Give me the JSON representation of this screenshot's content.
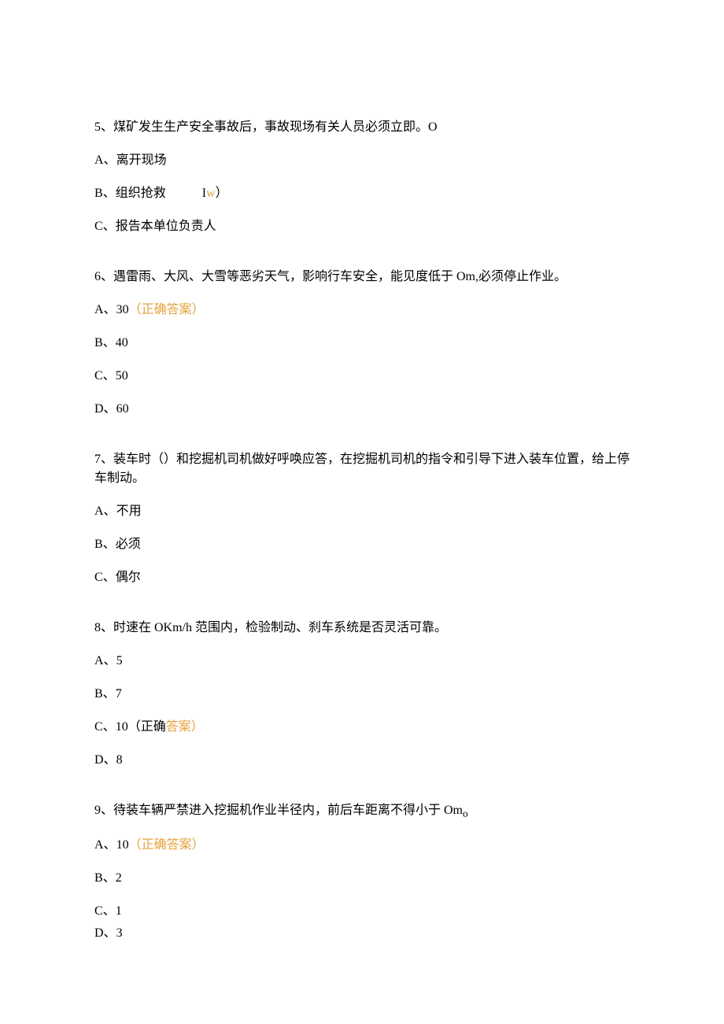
{
  "questions": [
    {
      "number": "5",
      "text": "、煤矿发生生产安全事故后，事故现场有关人员必须立即。O",
      "options": [
        {
          "label": "A、",
          "value": "离开现场",
          "inline_marker_prefix": "",
          "inline_marker_body": "",
          "inline_marker_suffix": ""
        },
        {
          "label": "B、",
          "value": "组织抢救",
          "inline_marker_prefix": "I",
          "inline_marker_body": "w",
          "inline_marker_suffix": "）"
        },
        {
          "label": "C、",
          "value": "报告本单位负责人",
          "inline_marker_prefix": "",
          "inline_marker_body": "",
          "inline_marker_suffix": ""
        }
      ]
    },
    {
      "number": "6",
      "text": "、遇雷雨、大风、大雪等恶劣天气，影响行车安全，能见度低于 Om,必须停止作业。",
      "options": [
        {
          "label": "A、",
          "value": "30",
          "correct_text": "（正确答案）"
        },
        {
          "label": "B、",
          "value": "40",
          "correct_text": ""
        },
        {
          "label": "C、",
          "value": "50",
          "correct_text": ""
        },
        {
          "label": "D、",
          "value": "60",
          "correct_text": ""
        }
      ]
    },
    {
      "number": "7",
      "text": "、装车时（）和挖掘机司机做好呼唤应答，在挖掘机司机的指令和引导下进入装车位置，给上停车制动。",
      "options": [
        {
          "label": "A、",
          "value": "不用"
        },
        {
          "label": "B、",
          "value": "必须"
        },
        {
          "label": "C、",
          "value": "偶尔"
        }
      ]
    },
    {
      "number": "8",
      "text": "、时速在 OKm/h 范围内，检验制动、刹车系统是否灵活可靠。",
      "options": [
        {
          "label": "A、",
          "value": "5",
          "correct_prefix": "",
          "correct_body": "",
          "correct_suffix": ""
        },
        {
          "label": "B、",
          "value": "7",
          "correct_prefix": "",
          "correct_body": "",
          "correct_suffix": ""
        },
        {
          "label": "C、",
          "value": "10",
          "correct_prefix": "（正确",
          "correct_body": "答案）",
          "correct_suffix": ""
        },
        {
          "label": "D、",
          "value": "8",
          "correct_prefix": "",
          "correct_body": "",
          "correct_suffix": ""
        }
      ]
    },
    {
      "number": "9",
      "text": "、待装车辆严禁进入挖掘机作业半径内，前后车距离不得小于 Om",
      "subscript": "o",
      "options": [
        {
          "label": "A、",
          "value": "10",
          "correct_text": "（正确答案）"
        },
        {
          "label": "B、",
          "value": "2",
          "correct_text": ""
        },
        {
          "label": "C、",
          "value": "1",
          "correct_text": ""
        },
        {
          "label": "D、",
          "value": "3",
          "correct_text": ""
        }
      ]
    }
  ]
}
